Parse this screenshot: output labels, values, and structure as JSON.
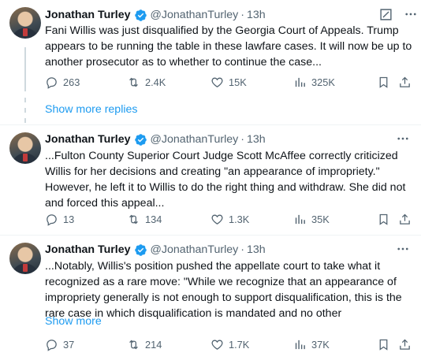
{
  "colors": {
    "link": "#1d9bf0",
    "muted": "#536471",
    "text": "#0f1419",
    "verified": "#1d9bf0"
  },
  "show_more_replies": "Show more replies",
  "tweets": [
    {
      "name": "Jonathan Turley",
      "handle": "@JonathanTurley",
      "time": "13h",
      "lines": [
        "Fani Willis was just disqualified by the Georgia Court of Appeals. Trump",
        "appears to be running the table in these lawfare cases. It will now be up to",
        "another prosecutor as to whether to continue the case..."
      ],
      "replies": "263",
      "reposts": "2.4K",
      "likes": "15K",
      "views": "325K"
    },
    {
      "name": "Jonathan Turley",
      "handle": "@JonathanTurley",
      "time": "13h",
      "lines": [
        "...Fulton County Superior Court Judge Scott McAffee correctly criticized",
        "Willis for her decisions and creating \"an appearance of impropriety.\"",
        "However, he left it to Willis to do the right thing and withdraw. She did not",
        "and forced this appeal..."
      ],
      "replies": "13",
      "reposts": "134",
      "likes": "1.3K",
      "views": "35K"
    },
    {
      "name": "Jonathan Turley",
      "handle": "@JonathanTurley",
      "time": "13h",
      "lines": [
        "...Notably, Willis's position pushed the appellate court to take what it",
        "recognized as a rare move: \"While we recognize that an appearance of",
        "impropriety generally is not enough to support disqualification, this is the",
        "rare case in which disqualification is mandated and no other"
      ],
      "show_more": "Show more",
      "replies": "37",
      "reposts": "214",
      "likes": "1.7K",
      "views": "37K"
    }
  ]
}
